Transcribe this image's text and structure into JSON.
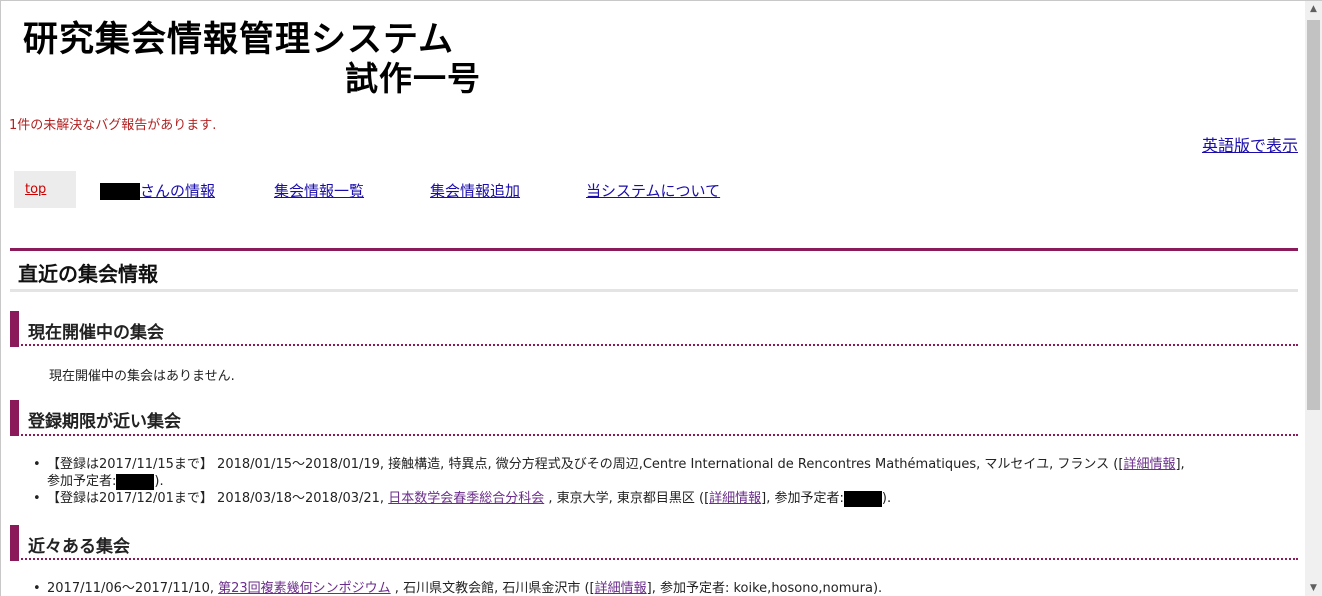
{
  "logo": {
    "line1": "研究集会情報管理システム",
    "line2": "試作一号"
  },
  "bug_notice": "1件の未解決なバグ報告があります.",
  "language_link": "英語版で表示",
  "nav": {
    "top": "top",
    "user_info_suffix": "さんの情報",
    "meeting_list": "集会情報一覧",
    "add_meeting": "集会情報追加",
    "about": "当システムについて"
  },
  "main_heading": "直近の集会情報",
  "sections": {
    "ongoing": {
      "title": "現在開催中の集会",
      "empty_text": "現在開催中の集会はありません."
    },
    "deadline": {
      "title": "登録期限が近い集会",
      "items": [
        {
          "prefix": "【登録は2017/11/15まで】 2018/01/15～2018/01/19, 接触構造, 特異点, 微分方程式及びその周辺,Centre International de Rencontres Mathématiques, マルセイユ, フランス (",
          "detail_link": "詳細情報",
          "line2_prefix": "参加予定者:",
          "line2_suffix": ")."
        },
        {
          "prefix": "【登録は2017/12/01まで】 2018/03/18～2018/03/21, ",
          "meeting_link": "日本数学会春季総合分科会",
          "middle": " , 東京大学, 東京都目黒区 (",
          "detail_link": "詳細情報",
          "after_detail": "], 参加予定者:",
          "suffix": ")."
        }
      ]
    },
    "upcoming": {
      "title": "近々ある集会",
      "items": [
        {
          "prefix": "2017/11/06～2017/11/10, ",
          "meeting_link": "第23回複素幾何シンポジウム",
          "middle": " , 石川県文教会館, 石川県金沢市 (",
          "detail_link": "詳細情報",
          "suffix": "], 参加予定者: koike,hosono,nomura)."
        }
      ]
    }
  },
  "scrollbar": {
    "up_icon": "▲",
    "down_icon": "▼"
  }
}
